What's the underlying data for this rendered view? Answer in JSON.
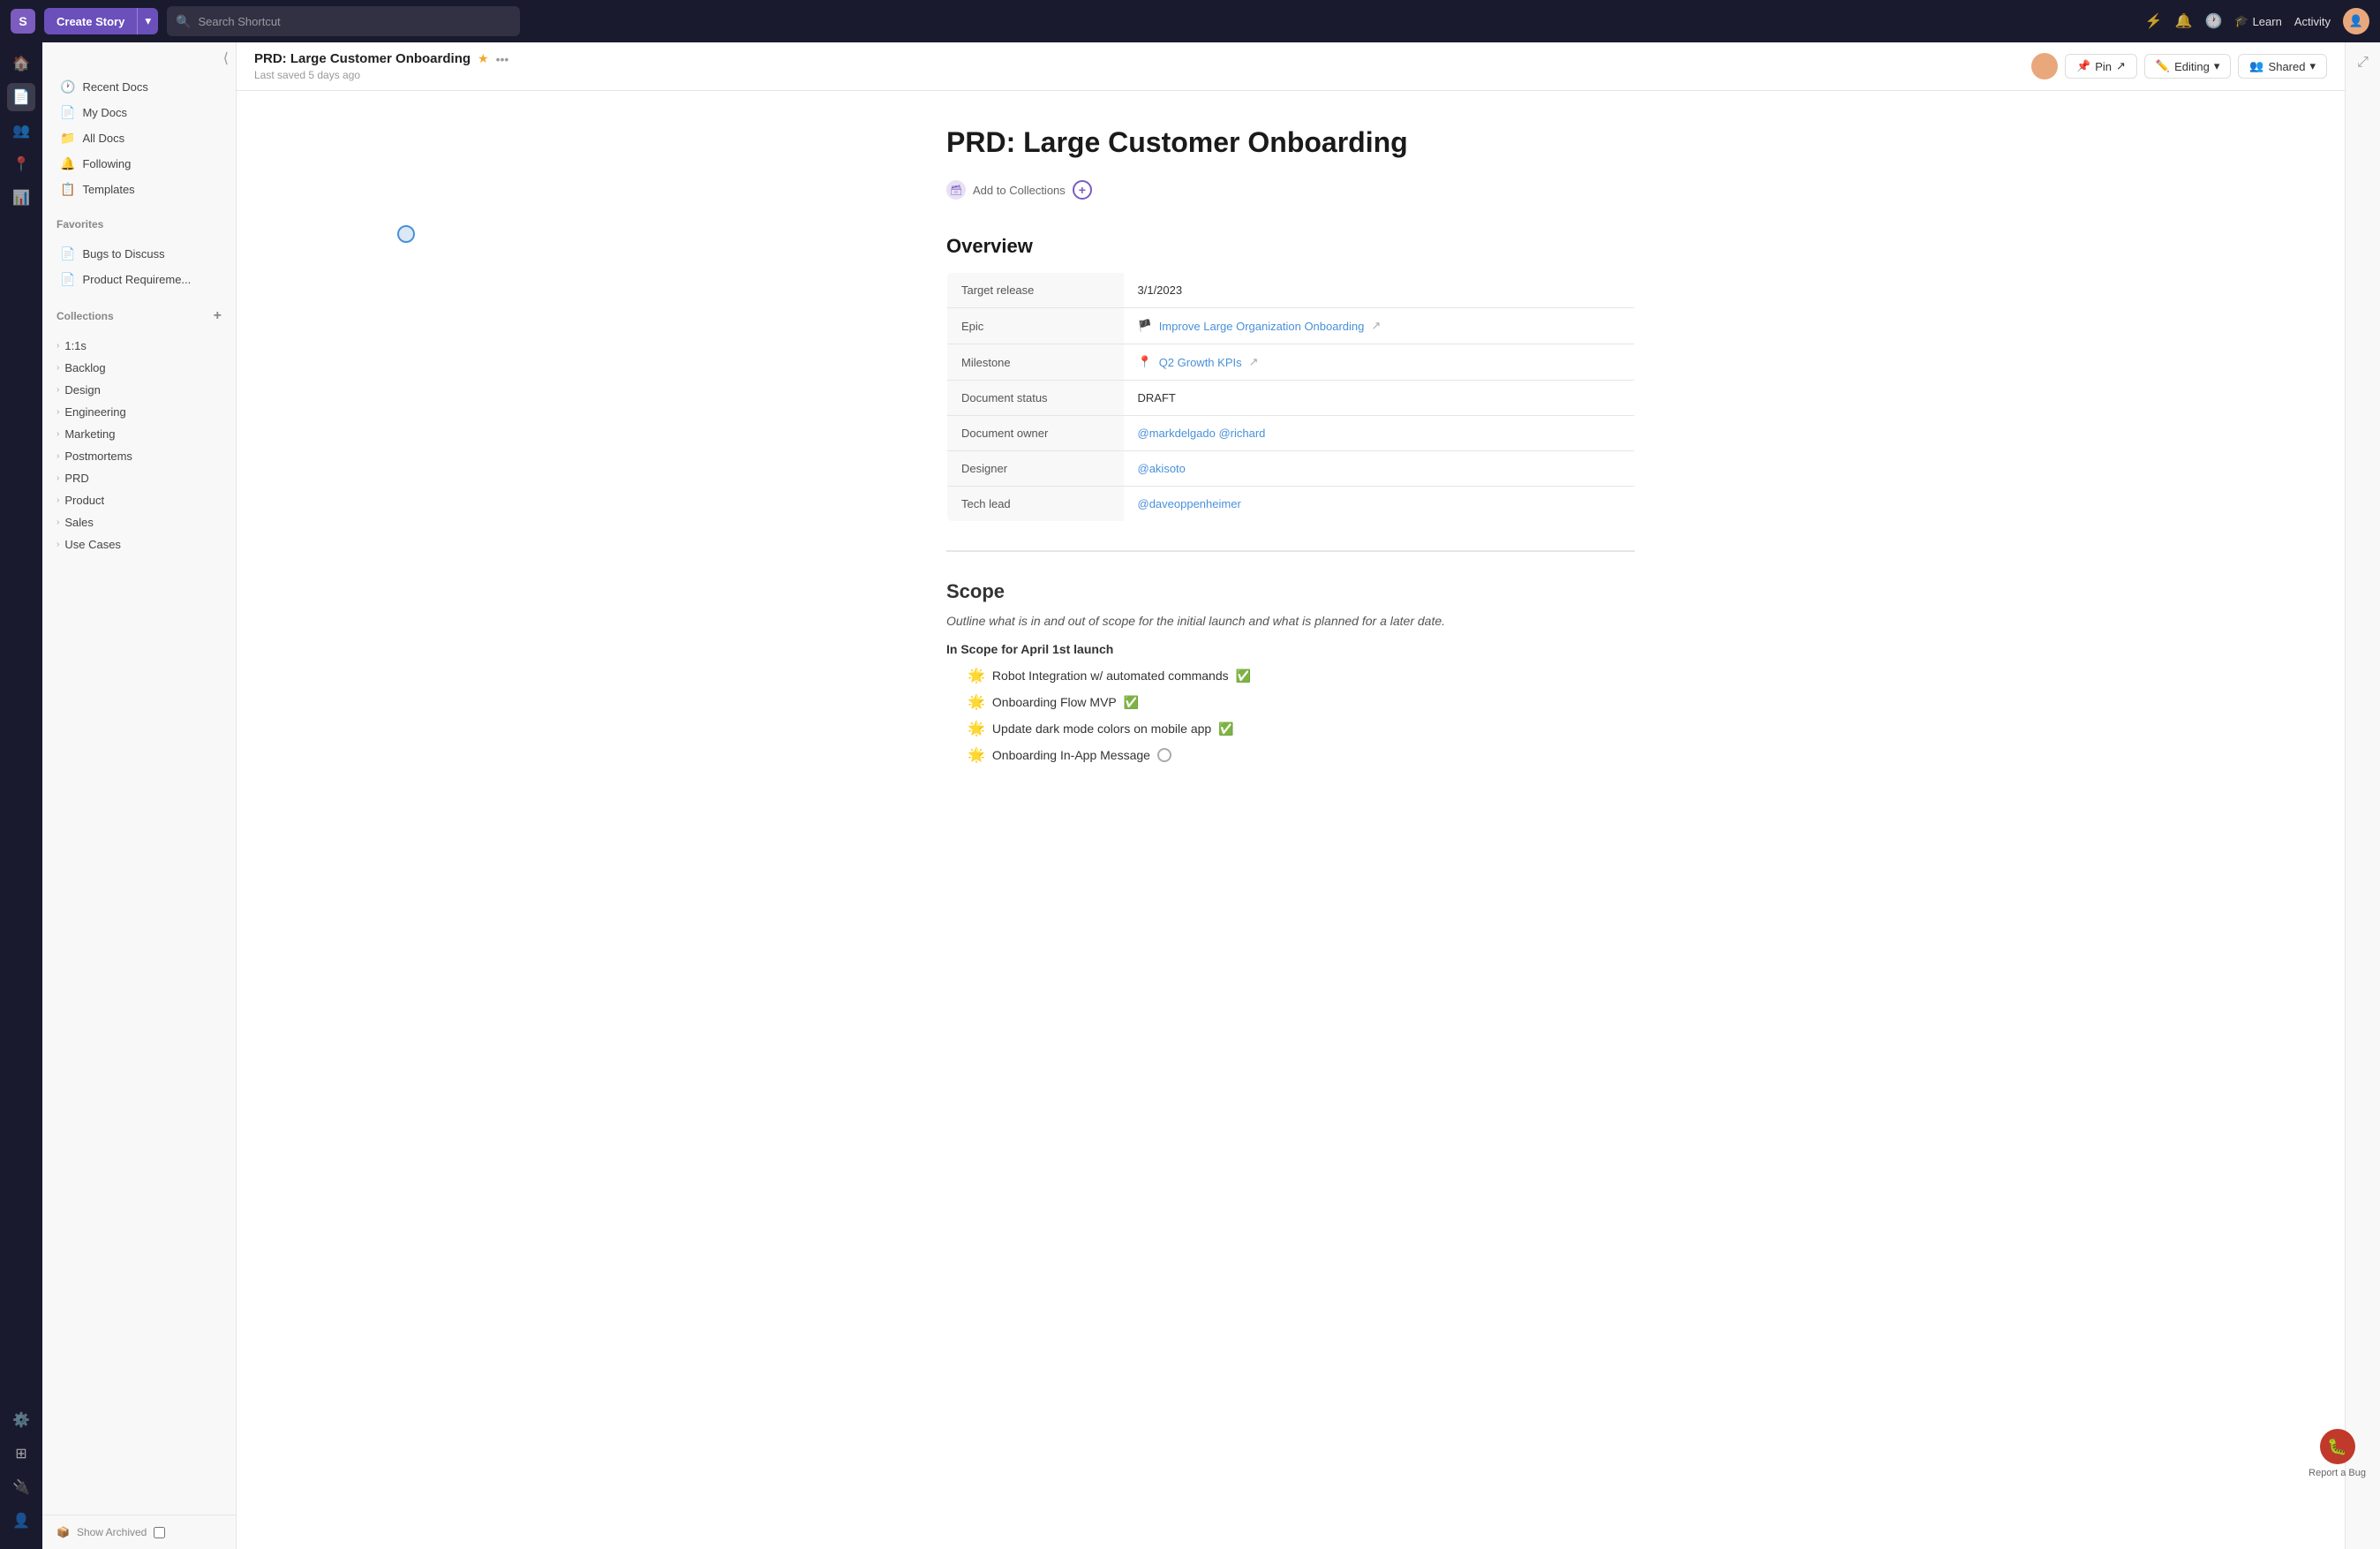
{
  "topNav": {
    "logo": "S",
    "createBtn": "Create Story",
    "searchPlaceholder": "Search Shortcut",
    "learnLabel": "Learn",
    "activityLabel": "Activity"
  },
  "sidebar": {
    "collapseTitle": "Collapse",
    "navItems": [
      {
        "id": "recent-docs",
        "label": "Recent Docs",
        "icon": "🕐"
      },
      {
        "id": "my-docs",
        "label": "My Docs",
        "icon": "📄"
      },
      {
        "id": "all-docs",
        "label": "All Docs",
        "icon": "📁"
      },
      {
        "id": "following",
        "label": "Following",
        "icon": "🔔"
      },
      {
        "id": "templates",
        "label": "Templates",
        "icon": "📋"
      }
    ],
    "favoritesLabel": "Favorites",
    "favorites": [
      {
        "id": "bugs-to-discuss",
        "label": "Bugs to Discuss",
        "icon": "📄"
      },
      {
        "id": "product-requirements",
        "label": "Product Requireme...",
        "icon": "📄"
      }
    ],
    "collectionsLabel": "Collections",
    "collectionsAddBtn": "+",
    "collections": [
      {
        "id": "1-1s",
        "label": "1:1s"
      },
      {
        "id": "backlog",
        "label": "Backlog"
      },
      {
        "id": "design",
        "label": "Design"
      },
      {
        "id": "engineering",
        "label": "Engineering"
      },
      {
        "id": "marketing",
        "label": "Marketing"
      },
      {
        "id": "postmortems",
        "label": "Postmortems"
      },
      {
        "id": "prd",
        "label": "PRD"
      },
      {
        "id": "product",
        "label": "Product"
      },
      {
        "id": "sales",
        "label": "Sales"
      },
      {
        "id": "use-cases",
        "label": "Use Cases"
      }
    ],
    "showArchivedLabel": "Show Archived"
  },
  "docHeader": {
    "title": "PRD: Large Customer Onboarding",
    "savedText": "Last saved 5 days ago",
    "pinLabel": "Pin",
    "editingLabel": "Editing",
    "sharedLabel": "Shared"
  },
  "docContent": {
    "mainTitle": "PRD: Large Customer Onboarding",
    "addToCollectionsLabel": "Add to Collections",
    "overviewTitle": "Overview",
    "table": {
      "rows": [
        {
          "label": "Target release",
          "value": "3/1/2023",
          "type": "text"
        },
        {
          "label": "Epic",
          "value": "Improve Large Organization Onboarding",
          "type": "epic"
        },
        {
          "label": "Milestone",
          "value": "Q2 Growth KPIs",
          "type": "milestone"
        },
        {
          "label": "Document status",
          "value": "DRAFT",
          "type": "text"
        },
        {
          "label": "Document owner",
          "value": "@markdelgado @richard",
          "type": "link"
        },
        {
          "label": "Designer",
          "value": "@akisoto",
          "type": "link"
        },
        {
          "label": "Tech lead",
          "value": "@daveoppenheimer",
          "type": "link"
        }
      ]
    },
    "scopeTitle": "Scope",
    "scopeDesc": "Outline what is in and out of scope for the initial launch and what is planned for a later date.",
    "inScopeTitle": "In Scope for April 1st launch",
    "scopeItems": [
      {
        "text": "Robot Integration w/ automated commands",
        "status": "done"
      },
      {
        "text": "Onboarding Flow MVP",
        "status": "done"
      },
      {
        "text": "Update dark mode colors on mobile app",
        "status": "done"
      },
      {
        "text": "Onboarding In-App Message",
        "status": "pending"
      }
    ]
  },
  "reportBug": {
    "label": "Report a Bug"
  }
}
